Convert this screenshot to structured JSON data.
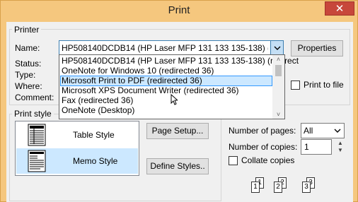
{
  "window": {
    "title": "Print",
    "close_glyph": "✕"
  },
  "printer": {
    "group_label": "Printer",
    "name_label": "Name:",
    "name_value": "HP508140DCDB14 (HP Laser MFP 131 133 135-138) (redirect",
    "properties_label": "Properties",
    "status_label": "Status:",
    "type_label": "Type:",
    "where_label": "Where:",
    "comment_label": "Comment:",
    "print_to_file_label": "Print to file",
    "print_to_file_checked": false
  },
  "dropdown": {
    "items": [
      "HP508140DCDB14 (HP Laser MFP 131 133 135-138) (redirect",
      "OneNote for Windows 10 (redirected 36)",
      "Microsoft Print to PDF (redirected 36)",
      "Microsoft XPS Document Writer (redirected 36)",
      "Fax (redirected 36)",
      "OneNote (Desktop)"
    ],
    "selected_index": 2,
    "scroll_up_glyph": "˄",
    "scroll_down_glyph": "˅"
  },
  "print_style": {
    "group_label": "Print style",
    "styles": [
      "Table Style",
      "Memo Style"
    ],
    "selected_index": 1,
    "page_setup_label": "Page Setup...",
    "define_styles_label": "Define Styles.."
  },
  "copies": {
    "pages_label": "Number of pages:",
    "pages_value": "All",
    "copies_label": "Number of copies:",
    "copies_value": "1",
    "collate_label": "Collate copies",
    "collate_checked": false,
    "collate_pages": [
      "1",
      "1",
      "2",
      "2",
      "3",
      "3"
    ]
  },
  "icons": {
    "close": "close-icon",
    "dropdown_arrow": "chevron-down-icon",
    "table_style": "table-style-icon",
    "memo_style": "memo-style-icon",
    "cursor": "mouse-pointer-icon"
  },
  "colors": {
    "title_bar": "#f5c77e",
    "close_button": "#c7473b",
    "selection": "#cce8ff",
    "selection_border": "#3399ff"
  }
}
